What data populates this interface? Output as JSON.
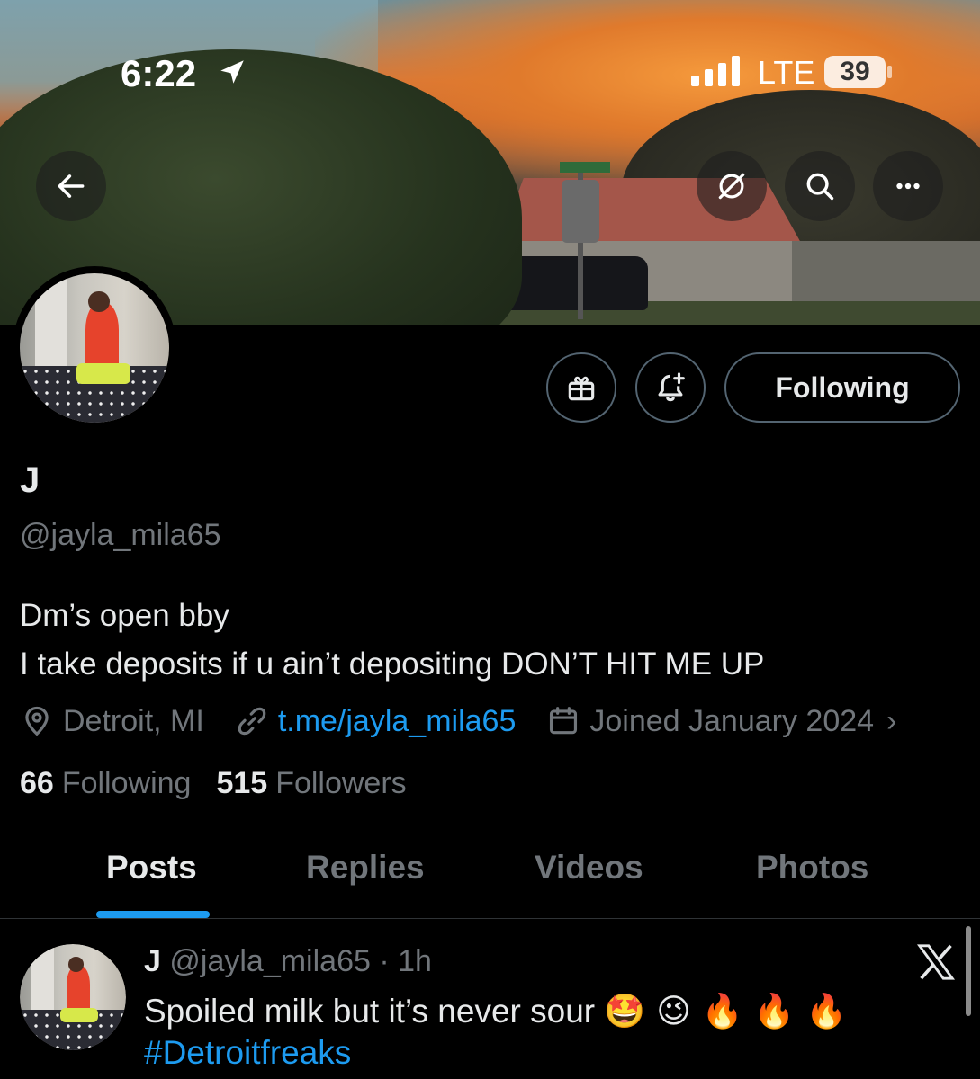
{
  "status_bar": {
    "time": "6:22",
    "network": "LTE",
    "battery": "39"
  },
  "profile": {
    "display_name": "J",
    "handle": "@jayla_mila65",
    "bio_line1": "Dm’s open bby",
    "bio_line2": "I take deposits if u ain’t depositing DON’T HIT ME UP",
    "location": "Detroit, MI",
    "link": "t.me/jayla_mila65",
    "joined": "Joined January 2024",
    "following_count": "66",
    "following_label": "Following",
    "followers_count": "515",
    "followers_label": "Followers"
  },
  "actions": {
    "following_button": "Following"
  },
  "tabs": [
    {
      "label": "Posts",
      "active": true
    },
    {
      "label": "Replies",
      "active": false
    },
    {
      "label": "Videos",
      "active": false
    },
    {
      "label": "Photos",
      "active": false
    }
  ],
  "post": {
    "name": "J",
    "handle": "@jayla_mila65",
    "time": "· 1h",
    "text": "Spoiled milk but it’s never sour",
    "emojis": "🤩 😉 🔥 🔥 🔥",
    "hashtag": "#Detroitfreaks"
  },
  "colors": {
    "accent": "#1d9bf0",
    "background": "#000000",
    "secondary_text": "#71767b"
  }
}
